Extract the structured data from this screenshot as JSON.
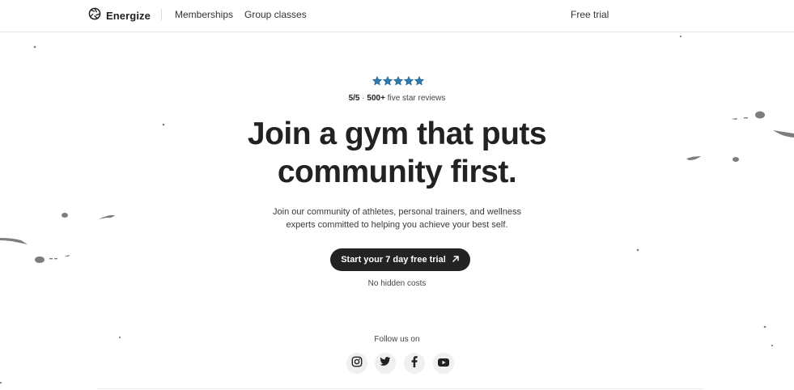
{
  "nav": {
    "brand": "Energize",
    "links": [
      "Memberships",
      "Group classes"
    ],
    "cta": "Free trial"
  },
  "hero": {
    "rating_value": "5/5",
    "rating_count": "500+",
    "rating_suffix": "five star reviews",
    "headline_line1": "Join a gym that puts",
    "headline_line2": "community first.",
    "sub_line1": "Join our community of athletes, personal trainers, and wellness",
    "sub_line2": "experts committed to helping you achieve your best self.",
    "cta_label": "Start your 7 day free trial",
    "cta_note": "No hidden costs",
    "star_count": 5,
    "star_color": "#2f7bb0"
  },
  "social": {
    "heading": "Follow us on",
    "icons": [
      "instagram-icon",
      "twitter-icon",
      "facebook-icon",
      "youtube-icon"
    ]
  },
  "colors": {
    "cta_bg": "#232323",
    "text": "#222222",
    "bird": "#7a7a7a"
  }
}
